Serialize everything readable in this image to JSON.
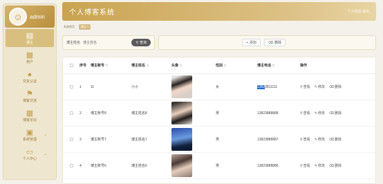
{
  "sidebar": {
    "brand": "admin",
    "items": [
      {
        "label": "博主",
        "icon": "document-icon",
        "active": true
      },
      {
        "label": "用户",
        "icon": "grid-icon"
      },
      {
        "label": "交友认证",
        "icon": "user-icon"
      },
      {
        "label": "博客交流",
        "icon": "flag-icon"
      },
      {
        "label": "博客论坛",
        "icon": "grid-icon"
      },
      {
        "label": "系统管理",
        "icon": "briefcase-icon",
        "dropdown": true
      },
      {
        "label": "个人中心",
        "icon": "card-icon",
        "dropdown": true
      }
    ]
  },
  "header": {
    "title": "个人博客系统",
    "right": "个人信息 退出"
  },
  "breadcrumb": {
    "home": "系统首页",
    "current": "博主 ×"
  },
  "search": {
    "label": "博主姓名",
    "placeholder": "博主姓名",
    "button": "查询"
  },
  "actions": {
    "add": "添加",
    "delete": "删除"
  },
  "table": {
    "headers": {
      "no": "序号",
      "account": "博主账号",
      "name": "博主姓名",
      "avatar": "头像",
      "gender": "性别",
      "phone": "博主电话",
      "ops": "操作"
    },
    "op_labels": {
      "view": "查看",
      "edit": "修改",
      "delete": "删除"
    },
    "rows": [
      {
        "no": "1",
        "account": "11",
        "name": "小小",
        "gender": "女",
        "phone_hl": "1382",
        "phone_rest": "3811111"
      },
      {
        "no": "2",
        "account": "博主账号8",
        "name": "博主姓名8",
        "gender": "男",
        "phone_hl": "",
        "phone_rest": "13823888888"
      },
      {
        "no": "3",
        "account": "博主账号7",
        "name": "博主姓名7",
        "gender": "男",
        "phone_hl": "",
        "phone_rest": "13823888887"
      },
      {
        "no": "4",
        "account": "博主账号6",
        "name": "博主姓名6",
        "gender": "男",
        "phone_hl": "",
        "phone_rest": "13823888886"
      }
    ]
  }
}
